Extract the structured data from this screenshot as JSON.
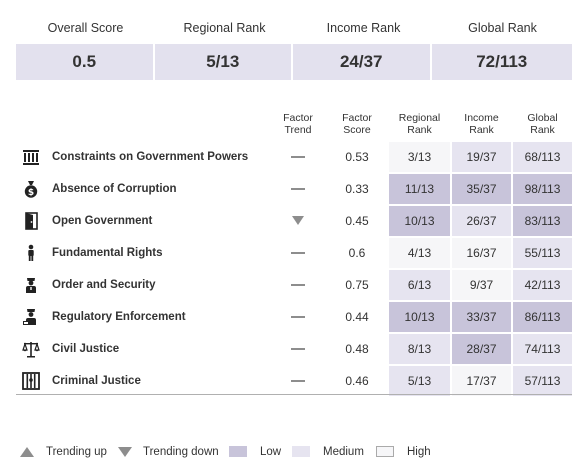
{
  "summary": {
    "labels": [
      "Overall Score",
      "Regional Rank",
      "Income Rank",
      "Global Rank"
    ],
    "values": [
      "0.5",
      "5/13",
      "24/37",
      "72/113"
    ]
  },
  "columns": {
    "trend": [
      "Factor",
      "Trend"
    ],
    "score": [
      "Factor",
      "Score"
    ],
    "regional": [
      "Regional",
      "Rank"
    ],
    "income": [
      "Income",
      "Rank"
    ],
    "global": [
      "Global",
      "Rank"
    ]
  },
  "colors": {
    "low": "#c8c4da",
    "medium": "#e6e4f0",
    "high": "#f6f6f8",
    "summary_bg": "#e3e1ee"
  },
  "factors": [
    {
      "icon": "government-building-icon",
      "name": "Constraints on Government Powers",
      "trend": "flat",
      "score": "0.53",
      "regional": "3/13",
      "regional_level": "high",
      "income": "19/37",
      "income_level": "medium",
      "global": "68/113",
      "global_level": "medium"
    },
    {
      "icon": "money-bag-icon",
      "name": "Absence of Corruption",
      "trend": "flat",
      "score": "0.33",
      "regional": "11/13",
      "regional_level": "low",
      "income": "35/37",
      "income_level": "low",
      "global": "98/113",
      "global_level": "low"
    },
    {
      "icon": "open-door-icon",
      "name": "Open Government",
      "trend": "down",
      "score": "0.45",
      "regional": "10/13",
      "regional_level": "low",
      "income": "26/37",
      "income_level": "medium",
      "global": "83/113",
      "global_level": "low"
    },
    {
      "icon": "person-icon",
      "name": "Fundamental Rights",
      "trend": "flat",
      "score": "0.6",
      "regional": "4/13",
      "regional_level": "high",
      "income": "16/37",
      "income_level": "high",
      "global": "55/113",
      "global_level": "medium"
    },
    {
      "icon": "police-officer-icon",
      "name": "Order and Security",
      "trend": "flat",
      "score": "0.75",
      "regional": "6/13",
      "regional_level": "medium",
      "income": "9/37",
      "income_level": "high",
      "global": "42/113",
      "global_level": "medium"
    },
    {
      "icon": "inspector-icon",
      "name": "Regulatory Enforcement",
      "trend": "flat",
      "score": "0.44",
      "regional": "10/13",
      "regional_level": "low",
      "income": "33/37",
      "income_level": "low",
      "global": "86/113",
      "global_level": "low"
    },
    {
      "icon": "scales-of-justice-icon",
      "name": "Civil Justice",
      "trend": "flat",
      "score": "0.48",
      "regional": "8/13",
      "regional_level": "medium",
      "income": "28/37",
      "income_level": "low",
      "global": "74/113",
      "global_level": "medium"
    },
    {
      "icon": "prison-bars-icon",
      "name": "Criminal Justice",
      "trend": "flat",
      "score": "0.46",
      "regional": "5/13",
      "regional_level": "medium",
      "income": "17/37",
      "income_level": "high",
      "global": "57/113",
      "global_level": "medium"
    }
  ],
  "legend": {
    "trending_up": "Trending up",
    "trending_down": "Trending down",
    "low": "Low",
    "medium": "Medium",
    "high": "High"
  }
}
